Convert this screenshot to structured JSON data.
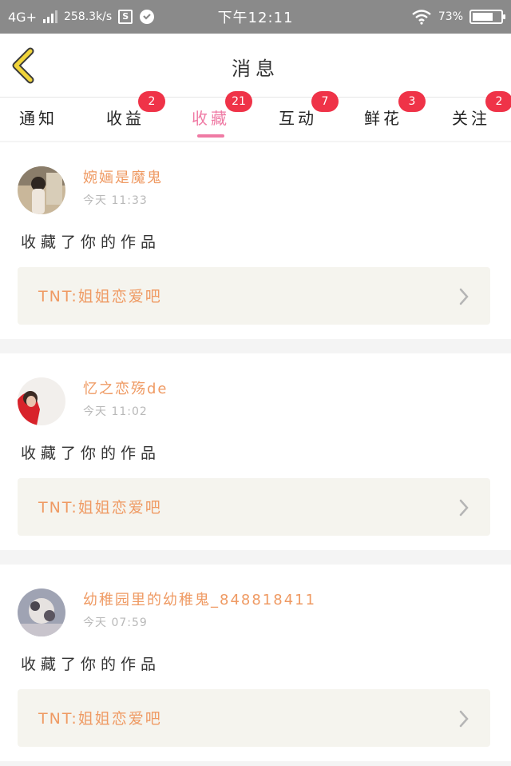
{
  "status_bar": {
    "network": "4G+",
    "speed": "258.3k/s",
    "time": "下午12:11",
    "battery": "73%",
    "battery_level": 0.73
  },
  "header": {
    "title": "消息"
  },
  "tabs": [
    {
      "label": "通知",
      "badge": "",
      "active": false
    },
    {
      "label": "收益",
      "badge": "2",
      "active": false
    },
    {
      "label": "收藏",
      "badge": "21",
      "active": true
    },
    {
      "label": "互动",
      "badge": "7",
      "active": false
    },
    {
      "label": "鲜花",
      "badge": "3",
      "active": false
    },
    {
      "label": "关注",
      "badge": "2",
      "active": false
    }
  ],
  "messages": [
    {
      "username": "婉婳是魔鬼",
      "time": "今天 11:33",
      "text": "收藏了你的作品",
      "work_title": "TNT:姐姐恋爱吧"
    },
    {
      "username": "忆之恋殇de",
      "time": "今天 11:02",
      "text": "收藏了你的作品",
      "work_title": "TNT:姐姐恋爱吧"
    },
    {
      "username": "幼稚园里的幼稚鬼_848818411",
      "time": "今天 07:59",
      "text": "收藏了你的作品",
      "work_title": "TNT:姐姐恋爱吧"
    }
  ],
  "colors": {
    "accent": "#ef7aa4",
    "badge": "#ef3348",
    "username": "#ef9a63",
    "back_arrow": "#f0d43a"
  }
}
